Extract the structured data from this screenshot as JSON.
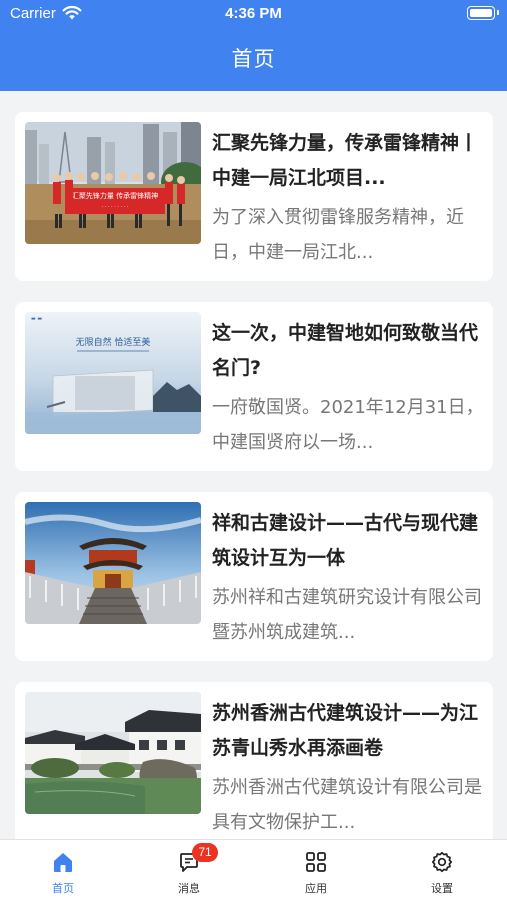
{
  "status_bar": {
    "carrier": "Carrier",
    "time": "4:36 PM"
  },
  "nav": {
    "title": "首页"
  },
  "articles": [
    {
      "title": "汇聚先锋力量，传承雷锋精神丨中建一局江北项目...",
      "summary": "为了深入贯彻雷锋服务精神，近日，中建一局江北...",
      "thumbnail": "group-photo-with-red-banner",
      "thumbnail_text": "汇聚先锋力量 传承雷锋精神"
    },
    {
      "title": "这一次，中建智地如何致敬当代名门?",
      "summary": "一府敬国贤。2021年12月31日，中建国贤府以一场...",
      "thumbnail": "glass-building-render",
      "thumbnail_text": "无限自然  恰适至美"
    },
    {
      "title": "祥和古建设计——古代与现代建筑设计互为一体",
      "summary": "苏州祥和古建筑研究设计有限公司暨苏州筑成建筑...",
      "thumbnail": "ancient-pavilion-bridge"
    },
    {
      "title": "苏州香洲古代建筑设计——为江苏青山秀水再添画卷",
      "summary": "苏州香洲古代建筑设计有限公司是具有文物保护工...",
      "thumbnail": "suzhou-garden-pond"
    }
  ],
  "tabbar": {
    "items": [
      {
        "label": "首页",
        "icon": "home-icon",
        "active": true
      },
      {
        "label": "消息",
        "icon": "message-icon",
        "badge": "71"
      },
      {
        "label": "应用",
        "icon": "apps-grid-icon"
      },
      {
        "label": "设置",
        "icon": "settings-gear-icon"
      }
    ]
  },
  "colors": {
    "primary": "#3f82f0",
    "badge": "#ea3323",
    "background": "#f2f3f5"
  }
}
